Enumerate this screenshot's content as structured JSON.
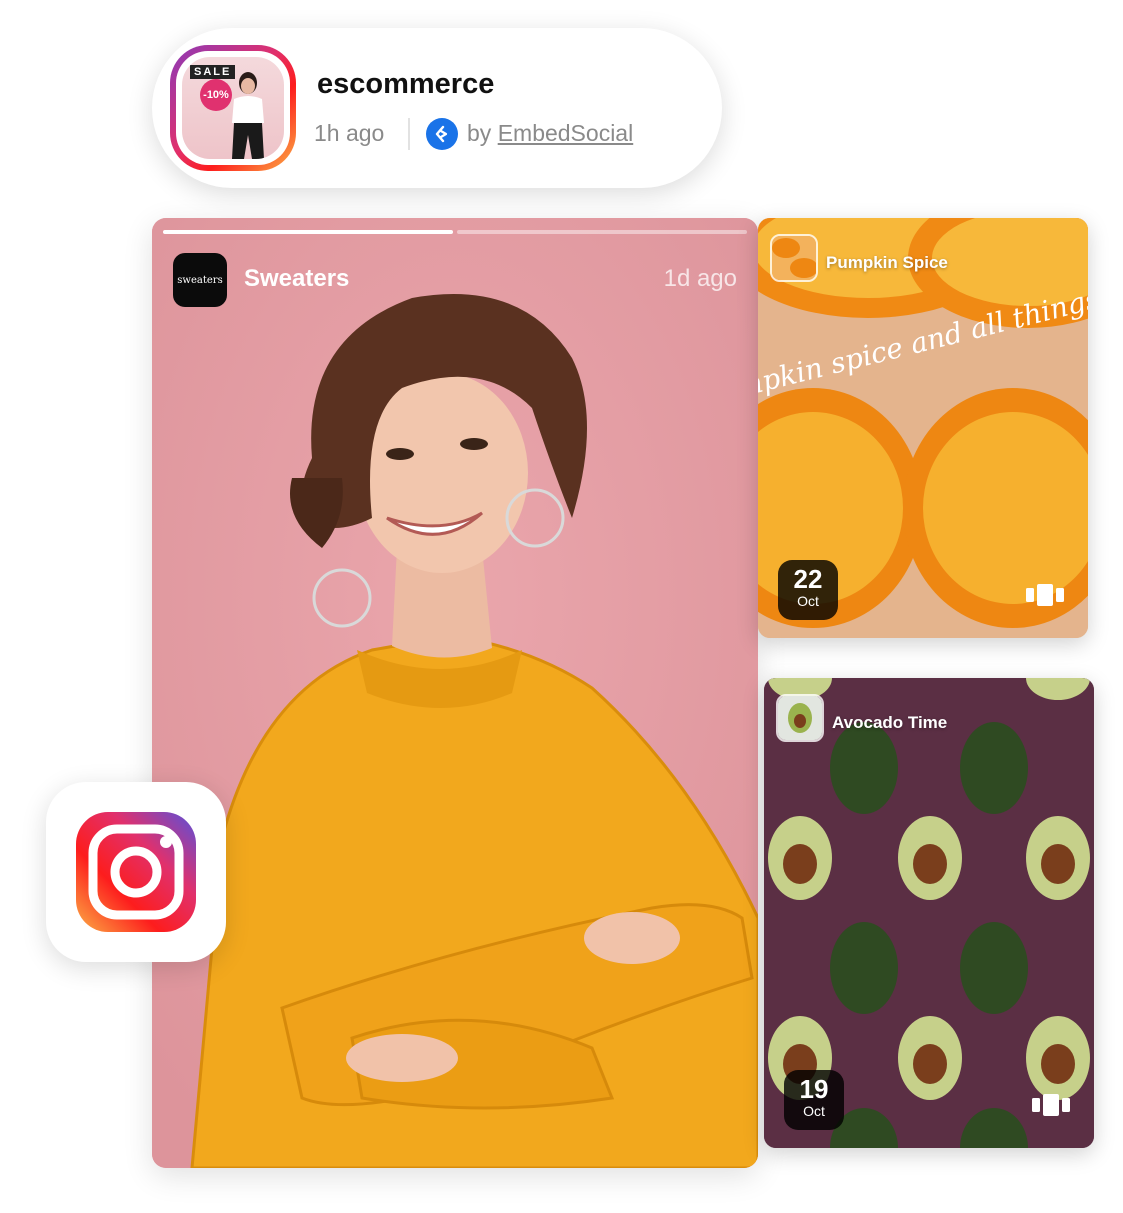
{
  "header": {
    "account_name": "escommerce",
    "time_ago": "1h ago",
    "by_prefix": "by",
    "provider_link": "EmbedSocial",
    "avatar": {
      "sale_tag": "SALE",
      "discount": "-10%"
    }
  },
  "main_story": {
    "account": "Sweaters",
    "logo_text": "sweaters",
    "time_ago": "1d ago",
    "progress_segments": [
      1,
      0
    ]
  },
  "side_stories": [
    {
      "title": "Pumpkin Spice",
      "day": "22",
      "month": "Oct",
      "overlay_text": "pumpkin spice and all things nice"
    },
    {
      "title": "Avocado Time",
      "day": "19",
      "month": "Oct"
    }
  ],
  "icons": {
    "platform": "instagram-icon",
    "provider": "embedsocial-icon",
    "carousel": "carousel-icon"
  },
  "colors": {
    "story_bg": "#e79fa5",
    "sweater": "#f2a81d",
    "ig_gradient": [
      "#8a3ab9",
      "#e1306c",
      "#fd1d1d",
      "#fcaf45"
    ]
  }
}
